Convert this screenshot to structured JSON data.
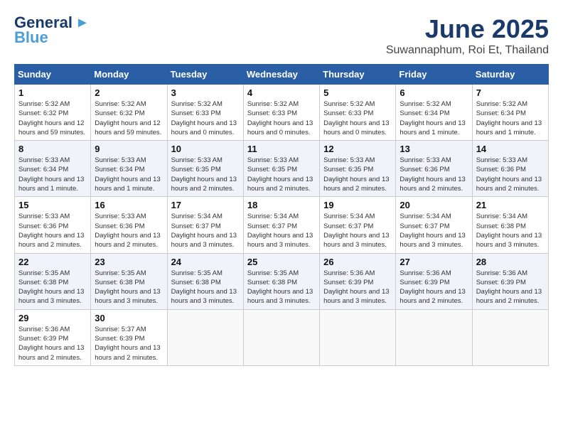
{
  "logo": {
    "line1": "General",
    "line2": "Blue"
  },
  "title": "June 2025",
  "location": "Suwannaphum, Roi Et, Thailand",
  "days_of_week": [
    "Sunday",
    "Monday",
    "Tuesday",
    "Wednesday",
    "Thursday",
    "Friday",
    "Saturday"
  ],
  "weeks": [
    [
      {
        "day": "1",
        "sunrise": "5:32 AM",
        "sunset": "6:32 PM",
        "daylight": "12 hours and 59 minutes."
      },
      {
        "day": "2",
        "sunrise": "5:32 AM",
        "sunset": "6:32 PM",
        "daylight": "12 hours and 59 minutes."
      },
      {
        "day": "3",
        "sunrise": "5:32 AM",
        "sunset": "6:33 PM",
        "daylight": "13 hours and 0 minutes."
      },
      {
        "day": "4",
        "sunrise": "5:32 AM",
        "sunset": "6:33 PM",
        "daylight": "13 hours and 0 minutes."
      },
      {
        "day": "5",
        "sunrise": "5:32 AM",
        "sunset": "6:33 PM",
        "daylight": "13 hours and 0 minutes."
      },
      {
        "day": "6",
        "sunrise": "5:32 AM",
        "sunset": "6:34 PM",
        "daylight": "13 hours and 1 minute."
      },
      {
        "day": "7",
        "sunrise": "5:32 AM",
        "sunset": "6:34 PM",
        "daylight": "13 hours and 1 minute."
      }
    ],
    [
      {
        "day": "8",
        "sunrise": "5:33 AM",
        "sunset": "6:34 PM",
        "daylight": "13 hours and 1 minute."
      },
      {
        "day": "9",
        "sunrise": "5:33 AM",
        "sunset": "6:34 PM",
        "daylight": "13 hours and 1 minute."
      },
      {
        "day": "10",
        "sunrise": "5:33 AM",
        "sunset": "6:35 PM",
        "daylight": "13 hours and 2 minutes."
      },
      {
        "day": "11",
        "sunrise": "5:33 AM",
        "sunset": "6:35 PM",
        "daylight": "13 hours and 2 minutes."
      },
      {
        "day": "12",
        "sunrise": "5:33 AM",
        "sunset": "6:35 PM",
        "daylight": "13 hours and 2 minutes."
      },
      {
        "day": "13",
        "sunrise": "5:33 AM",
        "sunset": "6:36 PM",
        "daylight": "13 hours and 2 minutes."
      },
      {
        "day": "14",
        "sunrise": "5:33 AM",
        "sunset": "6:36 PM",
        "daylight": "13 hours and 2 minutes."
      }
    ],
    [
      {
        "day": "15",
        "sunrise": "5:33 AM",
        "sunset": "6:36 PM",
        "daylight": "13 hours and 2 minutes."
      },
      {
        "day": "16",
        "sunrise": "5:33 AM",
        "sunset": "6:36 PM",
        "daylight": "13 hours and 2 minutes."
      },
      {
        "day": "17",
        "sunrise": "5:34 AM",
        "sunset": "6:37 PM",
        "daylight": "13 hours and 3 minutes."
      },
      {
        "day": "18",
        "sunrise": "5:34 AM",
        "sunset": "6:37 PM",
        "daylight": "13 hours and 3 minutes."
      },
      {
        "day": "19",
        "sunrise": "5:34 AM",
        "sunset": "6:37 PM",
        "daylight": "13 hours and 3 minutes."
      },
      {
        "day": "20",
        "sunrise": "5:34 AM",
        "sunset": "6:37 PM",
        "daylight": "13 hours and 3 minutes."
      },
      {
        "day": "21",
        "sunrise": "5:34 AM",
        "sunset": "6:38 PM",
        "daylight": "13 hours and 3 minutes."
      }
    ],
    [
      {
        "day": "22",
        "sunrise": "5:35 AM",
        "sunset": "6:38 PM",
        "daylight": "13 hours and 3 minutes."
      },
      {
        "day": "23",
        "sunrise": "5:35 AM",
        "sunset": "6:38 PM",
        "daylight": "13 hours and 3 minutes."
      },
      {
        "day": "24",
        "sunrise": "5:35 AM",
        "sunset": "6:38 PM",
        "daylight": "13 hours and 3 minutes."
      },
      {
        "day": "25",
        "sunrise": "5:35 AM",
        "sunset": "6:38 PM",
        "daylight": "13 hours and 3 minutes."
      },
      {
        "day": "26",
        "sunrise": "5:36 AM",
        "sunset": "6:39 PM",
        "daylight": "13 hours and 3 minutes."
      },
      {
        "day": "27",
        "sunrise": "5:36 AM",
        "sunset": "6:39 PM",
        "daylight": "13 hours and 2 minutes."
      },
      {
        "day": "28",
        "sunrise": "5:36 AM",
        "sunset": "6:39 PM",
        "daylight": "13 hours and 2 minutes."
      }
    ],
    [
      {
        "day": "29",
        "sunrise": "5:36 AM",
        "sunset": "6:39 PM",
        "daylight": "13 hours and 2 minutes."
      },
      {
        "day": "30",
        "sunrise": "5:37 AM",
        "sunset": "6:39 PM",
        "daylight": "13 hours and 2 minutes."
      },
      null,
      null,
      null,
      null,
      null
    ]
  ]
}
